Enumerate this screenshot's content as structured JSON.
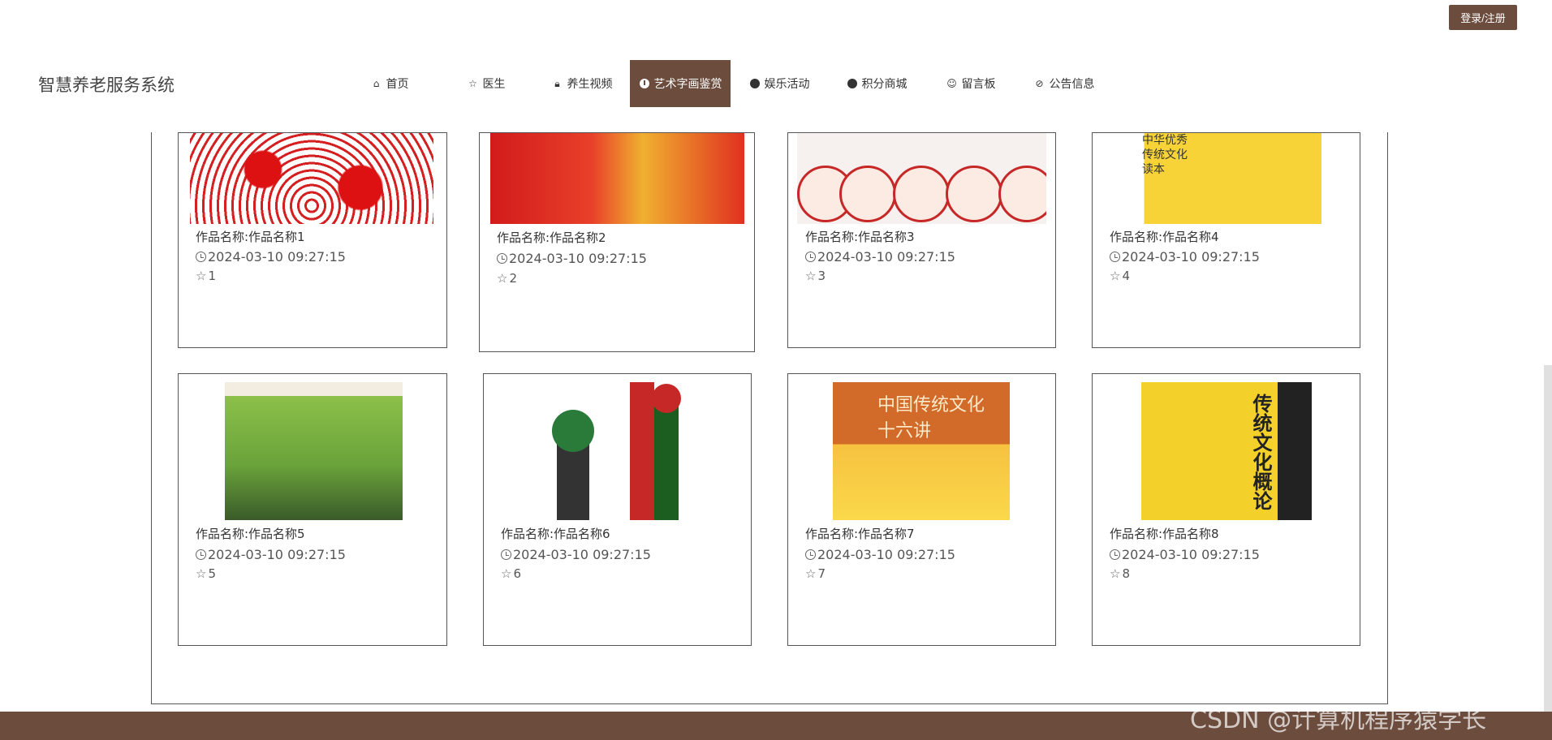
{
  "header": {
    "login_label": "登录/注册",
    "site_title": "智慧养老服务系统"
  },
  "nav": {
    "items": [
      {
        "label": "首页",
        "icon": "home-icon"
      },
      {
        "label": "医生",
        "icon": "star-icon"
      },
      {
        "label": "养生视频",
        "icon": "lock-icon"
      },
      {
        "label": "艺术字画鉴赏",
        "icon": "info-icon",
        "active": true
      },
      {
        "label": "娱乐活动",
        "icon": "question-icon"
      },
      {
        "label": "积分商城",
        "icon": "info-icon"
      },
      {
        "label": "留言板",
        "icon": "smile-icon"
      },
      {
        "label": "公告信息",
        "icon": "check-circle-icon"
      }
    ]
  },
  "cards": [
    {
      "name": "作品名称:作品名称1",
      "time": "2024-03-10 09:27:15",
      "likes": "1"
    },
    {
      "name": "作品名称:作品名称2",
      "time": "2024-03-10 09:27:15",
      "likes": "2"
    },
    {
      "name": "作品名称:作品名称3",
      "time": "2024-03-10 09:27:15",
      "likes": "3"
    },
    {
      "name": "作品名称:作品名称4",
      "time": "2024-03-10 09:27:15",
      "likes": "4"
    },
    {
      "name": "作品名称:作品名称5",
      "time": "2024-03-10 09:27:15",
      "likes": "5"
    },
    {
      "name": "作品名称:作品名称6",
      "time": "2024-03-10 09:27:15",
      "likes": "6"
    },
    {
      "name": "作品名称:作品名称7",
      "time": "2024-03-10 09:27:15",
      "likes": "7"
    },
    {
      "name": "作品名称:作品名称8",
      "time": "2024-03-10 09:27:15",
      "likes": "8"
    }
  ],
  "image_text": {
    "book4": "中华优秀\n传统文化\n读本",
    "book7": "中国传统文化\n十六讲",
    "book8": "传统文化概论"
  },
  "watermark": "CSDN @计算机程序猿学长",
  "colors": {
    "accent": "#6b4c3d",
    "footer": "#6b4c3d"
  }
}
